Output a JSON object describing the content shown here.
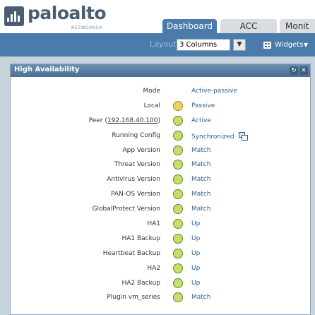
{
  "logo": {
    "name": "paloalto",
    "sub": "NETWORKS®"
  },
  "tabs": [
    {
      "label": "Dashboard",
      "active": true
    },
    {
      "label": "ACC",
      "active": false
    },
    {
      "label": "Monit",
      "active": false
    }
  ],
  "toolbar": {
    "layout_label": "Layout",
    "layout_value": "3 Columns",
    "widgets_label": "Widgets"
  },
  "widget": {
    "title": "High Availability",
    "rows": [
      {
        "label": "Mode",
        "value": "Active-passive",
        "status": "none"
      },
      {
        "label": "Local",
        "value": "Passive",
        "status": "passive"
      },
      {
        "label_prefix": "Peer (",
        "label_link": "192.168.40.100",
        "label_suffix": ")",
        "value": "Active",
        "status": "ok"
      },
      {
        "label": "Running Config",
        "value": "Synchronized",
        "status": "ok",
        "icon": "sync-icon"
      },
      {
        "label": "App Version",
        "value": "Match",
        "status": "ok"
      },
      {
        "label": "Threat Version",
        "value": "Match",
        "status": "ok"
      },
      {
        "label": "Antivirus Version",
        "value": "Match",
        "status": "ok"
      },
      {
        "label": "PAN-OS Version",
        "value": "Match",
        "status": "ok"
      },
      {
        "label": "GlobalProtect Version",
        "value": "Match",
        "status": "ok"
      },
      {
        "label": "HA1",
        "value": "Up",
        "status": "ok"
      },
      {
        "label": "HA1 Backup",
        "value": "Up",
        "status": "ok"
      },
      {
        "label": "Heartbeat Backup",
        "value": "Up",
        "status": "ok"
      },
      {
        "label": "HA2",
        "value": "Up",
        "status": "ok"
      },
      {
        "label": "HA2 Backup",
        "value": "Up",
        "status": "ok"
      },
      {
        "label": "Plugin vm_series",
        "value": "Match",
        "status": "ok"
      }
    ]
  },
  "colors": {
    "accent": "#4a7bab",
    "status_ok": "#c7dd6d",
    "status_passive": "#e9d15b",
    "value_text": "#2d5f8c"
  }
}
